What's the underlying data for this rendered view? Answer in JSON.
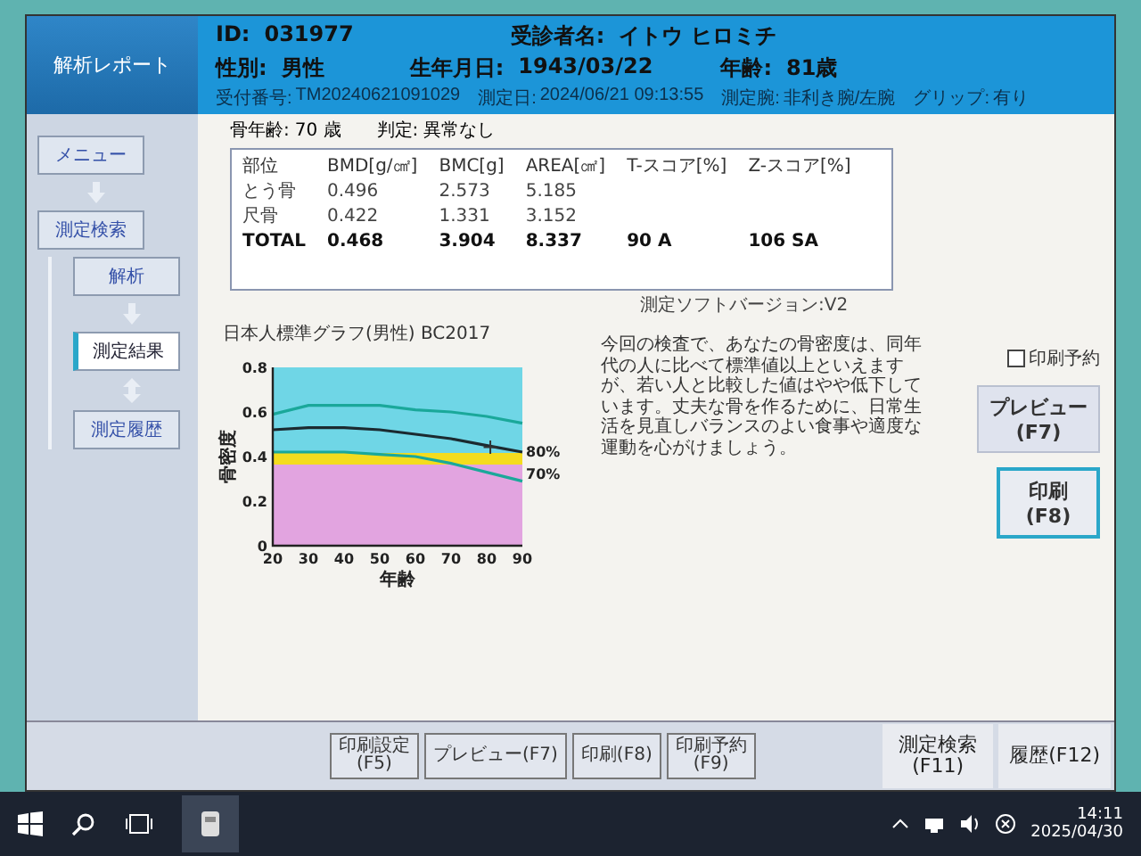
{
  "sidebar": {
    "title": "解析レポート",
    "items": [
      {
        "kind": "button",
        "label": "メニュー",
        "selected": false
      },
      {
        "kind": "arrow-down"
      },
      {
        "kind": "button",
        "label": "測定検索",
        "selected": false,
        "children": [
          {
            "kind": "button",
            "label": "解析",
            "selected": false
          },
          {
            "kind": "arrow-down"
          },
          {
            "kind": "button",
            "label": "測定結果",
            "selected": true
          },
          {
            "kind": "arrow-updown"
          },
          {
            "kind": "button",
            "label": "測定履歴",
            "selected": false
          }
        ]
      }
    ]
  },
  "patient": {
    "id_label": "ID:",
    "id": "031977",
    "name_label": "受診者名:",
    "name": "イトウ ヒロミチ",
    "sex_label": "性別:",
    "sex": "男性",
    "birth_label": "生年月日:",
    "birth": "1943/03/22",
    "age_label": "年齢:",
    "age": "81歳",
    "details": [
      {
        "label": "受付番号:",
        "value": "TM20240621091029"
      },
      {
        "label": "測定日:",
        "value": "2024/06/21 09:13:55"
      },
      {
        "label": "測定腕:",
        "value": "非利き腕/左腕"
      },
      {
        "label": "グリップ:",
        "value": "有り"
      }
    ]
  },
  "summary": [
    {
      "label": "骨年齢:",
      "value": "70 歳"
    },
    {
      "label": "判定:",
      "value": "異常なし"
    }
  ],
  "table": {
    "columns": [
      "部位",
      "BMD[g/㎠]",
      "BMC[g]",
      "AREA[㎠]",
      "T-スコア[%]",
      "Z-スコア[%]"
    ],
    "rows": [
      {
        "kind": "part",
        "cells": [
          "とう骨",
          "0.496",
          "2.573",
          "5.185",
          "",
          ""
        ]
      },
      {
        "kind": "part",
        "cells": [
          "尺骨",
          "0.422",
          "1.331",
          "3.152",
          "",
          ""
        ]
      },
      {
        "kind": "total",
        "cells": [
          "TOTAL",
          "0.468",
          "3.904",
          "8.337",
          "90 A",
          "106 SA"
        ]
      }
    ]
  },
  "version": "測定ソフトバージョン:V2",
  "graph": {
    "chart_data": {
      "type": "line",
      "title": "日本人標準グラフ(男性) BC2017",
      "xlabel": "年齢",
      "ylabel": "骨密度",
      "x": [
        20,
        30,
        40,
        50,
        60,
        70,
        80,
        90
      ],
      "series": [
        {
          "color": "#1aa89a",
          "values": [
            0.59,
            0.63,
            0.63,
            0.63,
            0.61,
            0.6,
            0.58,
            0.55
          ]
        },
        {
          "color": "#1b2a30",
          "values": [
            0.52,
            0.53,
            0.53,
            0.52,
            0.5,
            0.48,
            0.45,
            0.42
          ]
        },
        {
          "color": "#1aa89a",
          "values": [
            0.42,
            0.42,
            0.42,
            0.41,
            0.4,
            0.37,
            0.33,
            0.29
          ]
        }
      ],
      "xlim": [
        20,
        90
      ],
      "ylim": [
        0,
        0.8
      ],
      "xticks": [
        20,
        30,
        40,
        50,
        60,
        70,
        80,
        90
      ],
      "yticks": [
        0,
        0.2,
        0.4,
        0.6,
        0.8
      ],
      "annotations": [
        {
          "text": "+",
          "x": 80,
          "y": 0.468
        },
        "80%",
        "70%"
      ]
    }
  },
  "comment": "今回の検査で、あなたの骨密度は、同年代の人に比べて標準値以上といえますが、若い人と比較した値はやや低下しています。丈夫な骨を作るために、日常生活を見直しバランスのよい食事や適度な運動を心がけましょう。",
  "print_reserve": {
    "label": "印刷予約",
    "checked": false
  },
  "side_buttons": [
    {
      "label": "プレビュー",
      "key": "(F7)",
      "focused": false
    },
    {
      "label": "印刷",
      "key": "(F8)",
      "focused": true
    }
  ],
  "function_bar": [
    {
      "kind": "small",
      "label": "印刷設定",
      "key": "(F5)"
    },
    {
      "kind": "small",
      "label": "プレビュー(F7)"
    },
    {
      "kind": "small",
      "label": "印刷(F8)"
    },
    {
      "kind": "small",
      "label": "印刷予約",
      "key": "(F9)"
    },
    {
      "kind": "large",
      "label": "測定検索",
      "key": "(F11)"
    },
    {
      "kind": "large",
      "label": "履歴(F12)"
    }
  ],
  "taskbar": {
    "time": "14:11",
    "date": "2025/04/30"
  }
}
